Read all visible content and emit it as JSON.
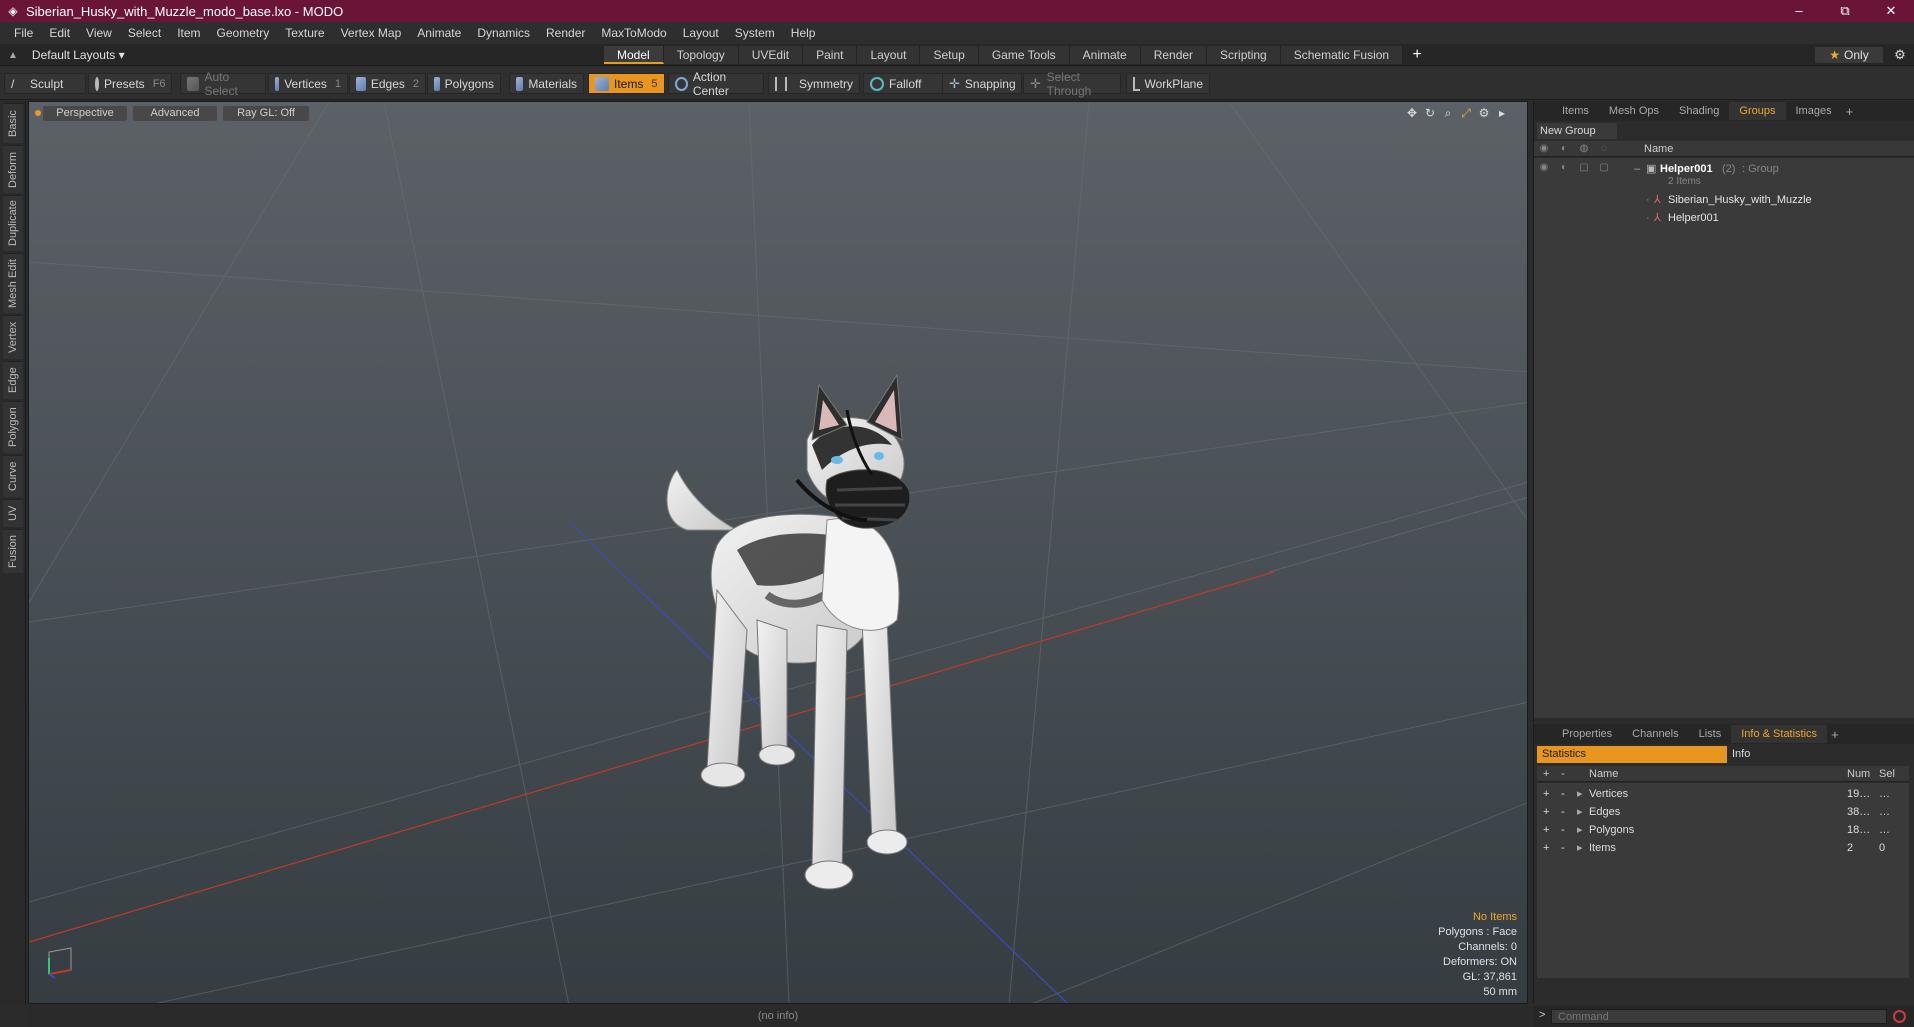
{
  "window": {
    "title": "Siberian_Husky_with_Muzzle_modo_base.lxo - MODO",
    "controls": [
      "–",
      "⧉",
      "✕"
    ]
  },
  "menu": [
    "File",
    "Edit",
    "View",
    "Select",
    "Item",
    "Geometry",
    "Texture",
    "Vertex Map",
    "Animate",
    "Dynamics",
    "Render",
    "MaxToModo",
    "Layout",
    "System",
    "Help"
  ],
  "layout": {
    "dropdown": "Default Layouts ▾",
    "tabs": [
      "Model",
      "Topology",
      "UVEdit",
      "Paint",
      "Layout",
      "Setup",
      "Game Tools",
      "Animate",
      "Render",
      "Scripting",
      "Schematic Fusion"
    ],
    "active_tab": "Model",
    "only": "Only"
  },
  "toolbar": {
    "sculpt": "Sculpt",
    "presets": "Presets",
    "presets_key": "F6",
    "auto_select": "Auto Select",
    "vertices": "Vertices",
    "vertices_key": "1",
    "edges": "Edges",
    "edges_key": "2",
    "polygons": "Polygons",
    "materials": "Materials",
    "items": "Items",
    "items_key": "5",
    "action_center": "Action Center",
    "symmetry": "Symmetry",
    "falloff": "Falloff",
    "snapping": "Snapping",
    "select_through": "Select Through",
    "workplane": "WorkPlane"
  },
  "left_tabs": [
    "Basic",
    "Deform",
    "Duplicate",
    "Mesh Edit",
    "Vertex",
    "Edge",
    "Polygon",
    "Curve",
    "UV",
    "Fusion"
  ],
  "viewport": {
    "perspective": "Perspective",
    "advanced": "Advanced",
    "raygl": "Ray GL: Off",
    "info": {
      "no_items": "No Items",
      "polygons": "Polygons : Face",
      "channels": "Channels: 0",
      "deformers": "Deformers: ON",
      "gl": "GL: 37,861",
      "lens": "50 mm"
    }
  },
  "groups_panel": {
    "tabs": [
      "Items",
      "Mesh Ops",
      "Shading",
      "Groups",
      "Images"
    ],
    "active_tab": "Groups",
    "new_group": "New Group",
    "col_name": "Name",
    "group_name": "Helper001",
    "group_count": "(2)",
    "group_type": ": Group",
    "group_items": "2 Items",
    "children": [
      "Siberian_Husky_with_Muzzle",
      "Helper001"
    ]
  },
  "stats_panel": {
    "tabs": [
      "Properties",
      "Channels",
      "Lists",
      "Info & Statistics"
    ],
    "active_tab": "Info & Statistics",
    "sub_tabs": [
      "Statistics",
      "Info"
    ],
    "cols": {
      "name": "Name",
      "num": "Num",
      "sel": "Sel"
    },
    "rows": [
      {
        "name": "Vertices",
        "num": "19…",
        "sel": "…"
      },
      {
        "name": "Edges",
        "num": "38…",
        "sel": "…"
      },
      {
        "name": "Polygons",
        "num": "18…",
        "sel": "…"
      },
      {
        "name": "Items",
        "num": "2",
        "sel": "0"
      }
    ]
  },
  "status": {
    "no_info": "(no info)",
    "command_placeholder": "Command",
    "prompt": ">"
  },
  "colors": {
    "title_bar": "#6a1538",
    "accent": "#e8961f"
  }
}
